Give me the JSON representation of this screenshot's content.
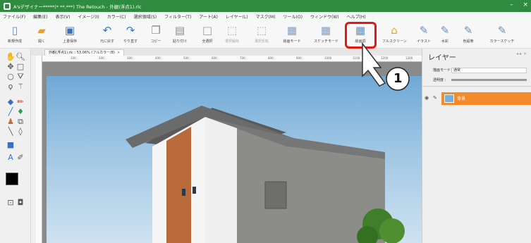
{
  "window": {
    "title": "A'sデザイナー*****(* **.***) The Retouch - 外観(浮点1).rlc",
    "minimize": "–",
    "close": "×"
  },
  "menu": [
    "ファイル(F)",
    "編集(E)",
    "表示(V)",
    "イメージ(I)",
    "カラー(C)",
    "選択領域(S)",
    "フィルター(T)",
    "アート(A)",
    "レイヤー(L)",
    "マスク(M)",
    "ツール(O)",
    "ウィンドウ(W)",
    "ヘルプ(H)"
  ],
  "toolbar": {
    "new": "新規作成",
    "open": "開く",
    "save": "上書保存",
    "undo": "元に戻す",
    "redo": "やり直す",
    "copy": "コピー",
    "paste": "貼り付け",
    "select_all": "全選択",
    "deselect": "選択解除",
    "select_inv": "選択反転",
    "draw_mode": "絵画モード",
    "sketch_mode": "スケッチモード",
    "painting": "絵画調",
    "fullscreen": "フルスクリーン",
    "illust": "イラスト",
    "watercolor": "水彩",
    "colored_pencil": "色鉛筆",
    "color_sketch": "カラースケッチ"
  },
  "document_tab": {
    "label": "外観(浮点1).rlc : 53.06% (フルカラー/8)",
    "close": "×"
  },
  "ruler_ticks": [
    "100",
    "200",
    "300",
    "400",
    "500",
    "600",
    "700",
    "800",
    "900",
    "1000",
    "1100",
    "1200",
    "1300"
  ],
  "callout": {
    "number": "1"
  },
  "layer_panel": {
    "title": "レイヤー",
    "blend_label": "描画モード :",
    "blend_value": "通常",
    "opacity_label": "透明度 :",
    "opacity": 1.0,
    "layer_name": "背景"
  },
  "colors": {
    "title_bar": "#2e8b3f",
    "highlight": "#e01818",
    "selected_layer": "#f38b2b"
  }
}
